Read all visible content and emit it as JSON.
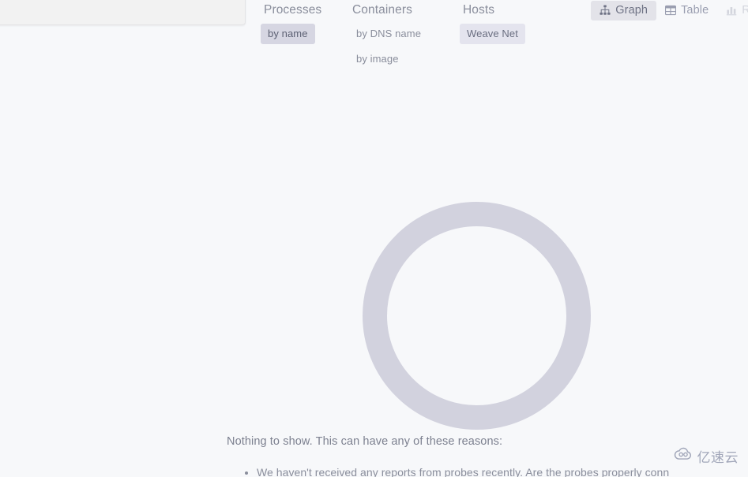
{
  "colors": {
    "page_background": "#f7f8fa",
    "panel_background": "#f2f2f2",
    "selected_pill": "#d6d6e2",
    "sub_selected_pill": "#e4e4ee",
    "active_view_button": "#e3e3e9",
    "ring": "#d2d2de",
    "muted_text": "#8a8e9c"
  },
  "search_panel": {
    "name": "search-panel"
  },
  "topology_selector": {
    "columns": [
      {
        "title": "Processes",
        "icon": "processes-icon",
        "options": [
          {
            "label": "by name",
            "state": "selected"
          }
        ]
      },
      {
        "title": "Containers",
        "icon": "containers-icon",
        "options": [
          {
            "label": "by DNS name",
            "state": "default"
          },
          {
            "label": "by image",
            "state": "default"
          }
        ]
      },
      {
        "title": "Hosts",
        "icon": "hosts-icon",
        "options": [
          {
            "label": "Weave Net",
            "state": "sub-selected"
          }
        ]
      }
    ]
  },
  "view_mode_bar": {
    "buttons": [
      {
        "label": "Graph",
        "icon": "graph-icon",
        "active": true,
        "truncated": false
      },
      {
        "label": "Table",
        "icon": "table-icon",
        "active": false,
        "truncated": false
      },
      {
        "label": "Re",
        "icon": "resources-icon",
        "active": false,
        "truncated": true
      }
    ]
  },
  "loading": {
    "indicator": "loading-ring-spinner"
  },
  "empty_state": {
    "title": "Nothing to show. This can have any of these reasons:",
    "reasons": [
      "We haven't received any reports from probes recently. Are the probes properly conn"
    ]
  },
  "watermark": {
    "text": "亿速云",
    "icon": "cloud-logo-icon"
  }
}
